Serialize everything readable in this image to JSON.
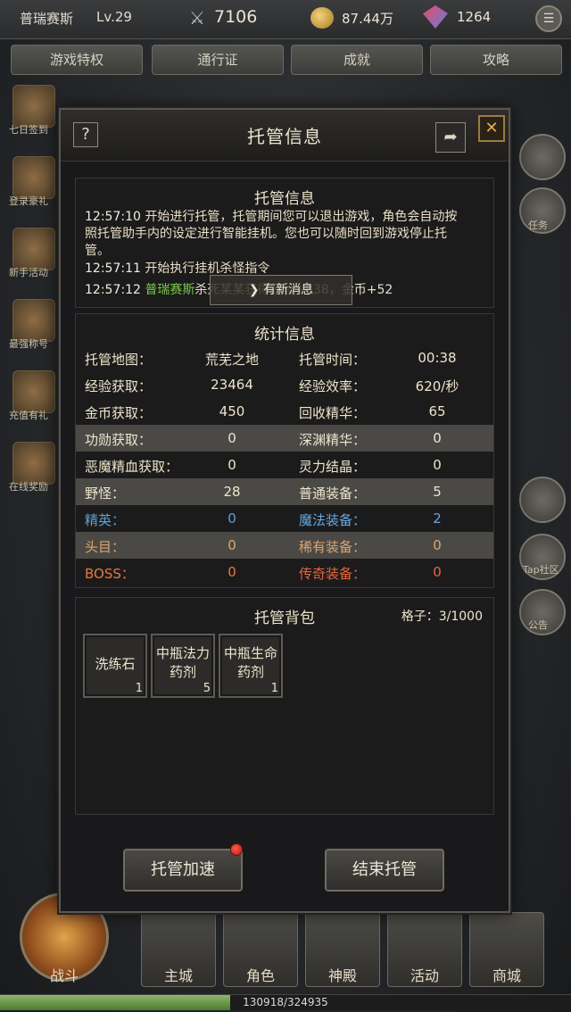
{
  "player": {
    "name": "普瑞赛斯",
    "level": "Lv.29",
    "power": "7106",
    "gold": "87.44万",
    "gems": "1264"
  },
  "nav_tabs": [
    "游戏特权",
    "通行证",
    "成就",
    "攻略"
  ],
  "left_side_labels": [
    "七日签到",
    "登录豪礼",
    "新手活动",
    "最强称号",
    "充值有礼",
    "在线奖励"
  ],
  "right_side_labels": [
    "任务",
    "Tap社区",
    "公告"
  ],
  "modal": {
    "title": "托管信息",
    "help_label": "?",
    "share_label": "➦",
    "close_label": "✕",
    "log": {
      "title": "托管信息",
      "lines": [
        {
          "time": "12:57:10",
          "text": "开始进行托管，托管期间您可以退出游戏，角色会自动按照托管助手内的设定进行智能挂机。您也可以随时回到游戏停止托管。"
        },
        {
          "time": "12:57:11",
          "text": "开始执行挂机杀怪指令"
        },
        {
          "time": "12:57:12",
          "name": "普瑞赛斯",
          "text": "杀死某某获得经验+838，金币+52"
        }
      ],
      "new_message": "有新消息"
    },
    "stats": {
      "title": "统计信息",
      "rows": [
        {
          "l1": "托管地图：",
          "v1": "荒芜之地",
          "l2": "托管时间：",
          "v2": "00:38"
        },
        {
          "l1": "经验获取：",
          "v1": "23464",
          "l2": "经验效率：",
          "v2": "620/秒"
        },
        {
          "l1": "金币获取：",
          "v1": "450",
          "l2": "回收精华：",
          "v2": "65"
        },
        {
          "l1": "功勋获取：",
          "v1": "0",
          "l2": "深渊精华：",
          "v2": "0"
        },
        {
          "l1": "恶魔精血获取：",
          "v1": "0",
          "l2": "灵力结晶：",
          "v2": "0"
        },
        {
          "l1": "野怪：",
          "v1": "28",
          "l2": "普通装备：",
          "v2": "5"
        },
        {
          "l1": "精英：",
          "v1": "0",
          "l2": "魔法装备：",
          "v2": "2"
        },
        {
          "l1": "头目：",
          "v1": "0",
          "l2": "稀有装备：",
          "v2": "0"
        },
        {
          "l1": "BOSS：",
          "v1": "0",
          "l2": "传奇装备：",
          "v2": "0"
        }
      ]
    },
    "bag": {
      "title": "托管背包",
      "slots_label": "格子：3/1000",
      "items": [
        {
          "name": "洗练石",
          "count": "1"
        },
        {
          "name": "中瓶法力药剂",
          "count": "5"
        },
        {
          "name": "中瓶生命药剂",
          "count": "1"
        }
      ]
    },
    "buttons": {
      "speedup": "托管加速",
      "end": "结束托管"
    }
  },
  "bottom_nav": {
    "fight": "战斗",
    "items": [
      "主城",
      "角色",
      "神殿",
      "活动",
      "商城"
    ]
  },
  "exp": {
    "text": "130918/324935",
    "fraction": 0.403
  },
  "colors": {
    "green_name": "#7ac74a",
    "elite_blue": "#5f9fd6",
    "boss_orange": "#e8773d",
    "legend_red": "#e8653b",
    "notify_red": "#d01e14",
    "close_gold": "#e0ae54"
  }
}
